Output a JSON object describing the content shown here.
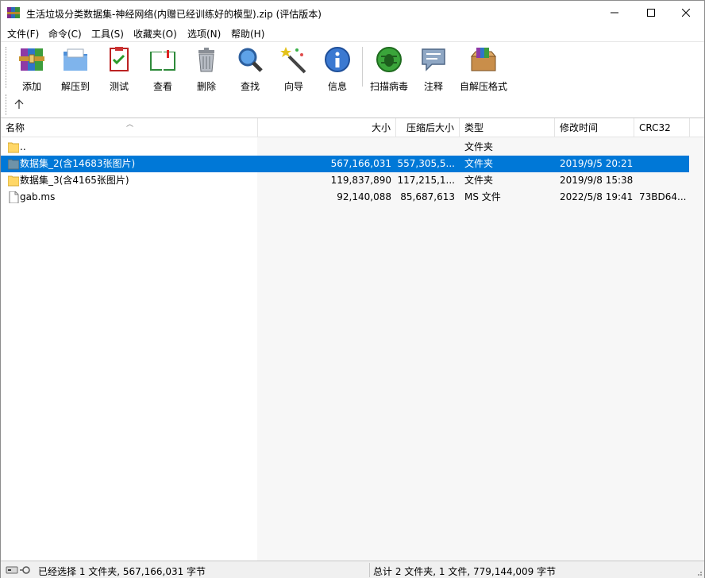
{
  "window": {
    "title": "生活垃圾分类数据集-神经网络(内赠已经训练好的模型).zip (评估版本)",
    "app_icon": "winrar-books-icon",
    "controls": [
      "minimize-icon",
      "maximize-icon",
      "close-icon"
    ]
  },
  "menu": [
    "文件(F)",
    "命令(C)",
    "工具(S)",
    "收藏夹(O)",
    "选项(N)",
    "帮助(H)"
  ],
  "toolbar": [
    {
      "label": "添加",
      "icon": "add-archive-icon"
    },
    {
      "label": "解压到",
      "icon": "extract-to-icon"
    },
    {
      "label": "测试",
      "icon": "test-archive-icon"
    },
    {
      "label": "查看",
      "icon": "view-book-icon"
    },
    {
      "label": "删除",
      "icon": "delete-trash-icon"
    },
    {
      "label": "查找",
      "icon": "find-magnifier-icon"
    },
    {
      "label": "向导",
      "icon": "wizard-wand-icon"
    },
    {
      "label": "信息",
      "icon": "info-icon"
    },
    {
      "label": "扫描病毒",
      "icon": "virus-scan-icon"
    },
    {
      "label": "注释",
      "icon": "comment-icon"
    },
    {
      "label": "自解压格式",
      "icon": "sfx-box-icon"
    }
  ],
  "list": {
    "columns": [
      "名称",
      "大小",
      "压缩后大小",
      "类型",
      "修改时间",
      "CRC32"
    ],
    "rows": [
      {
        "name": "..",
        "size": "",
        "packed": "",
        "type": "文件夹",
        "modified": "",
        "crc": "",
        "icon": "folder-icon",
        "selected": false
      },
      {
        "name": "数据集_2(含14683张图片)",
        "size": "567,166,031",
        "packed": "557,305,5...",
        "type": "文件夹",
        "modified": "2019/9/5 20:21",
        "crc": "",
        "icon": "folder-icon",
        "selected": true
      },
      {
        "name": "数据集_3(含4165张图片)",
        "size": "119,837,890",
        "packed": "117,215,1...",
        "type": "文件夹",
        "modified": "2019/9/8 15:38",
        "crc": "",
        "icon": "folder-icon",
        "selected": false
      },
      {
        "name": "gab.ms",
        "size": "92,140,088",
        "packed": "85,687,613",
        "type": "MS 文件",
        "modified": "2022/5/8 19:41",
        "crc": "73BD64...",
        "icon": "file-icon",
        "selected": false
      }
    ]
  },
  "status": {
    "left": "已经选择 1 文件夹, 567,166,031 字节",
    "right": "总计 2 文件夹, 1 文件, 779,144,009 字节"
  },
  "colors": {
    "selection": "#0078d7",
    "folder": "#ffd767"
  }
}
